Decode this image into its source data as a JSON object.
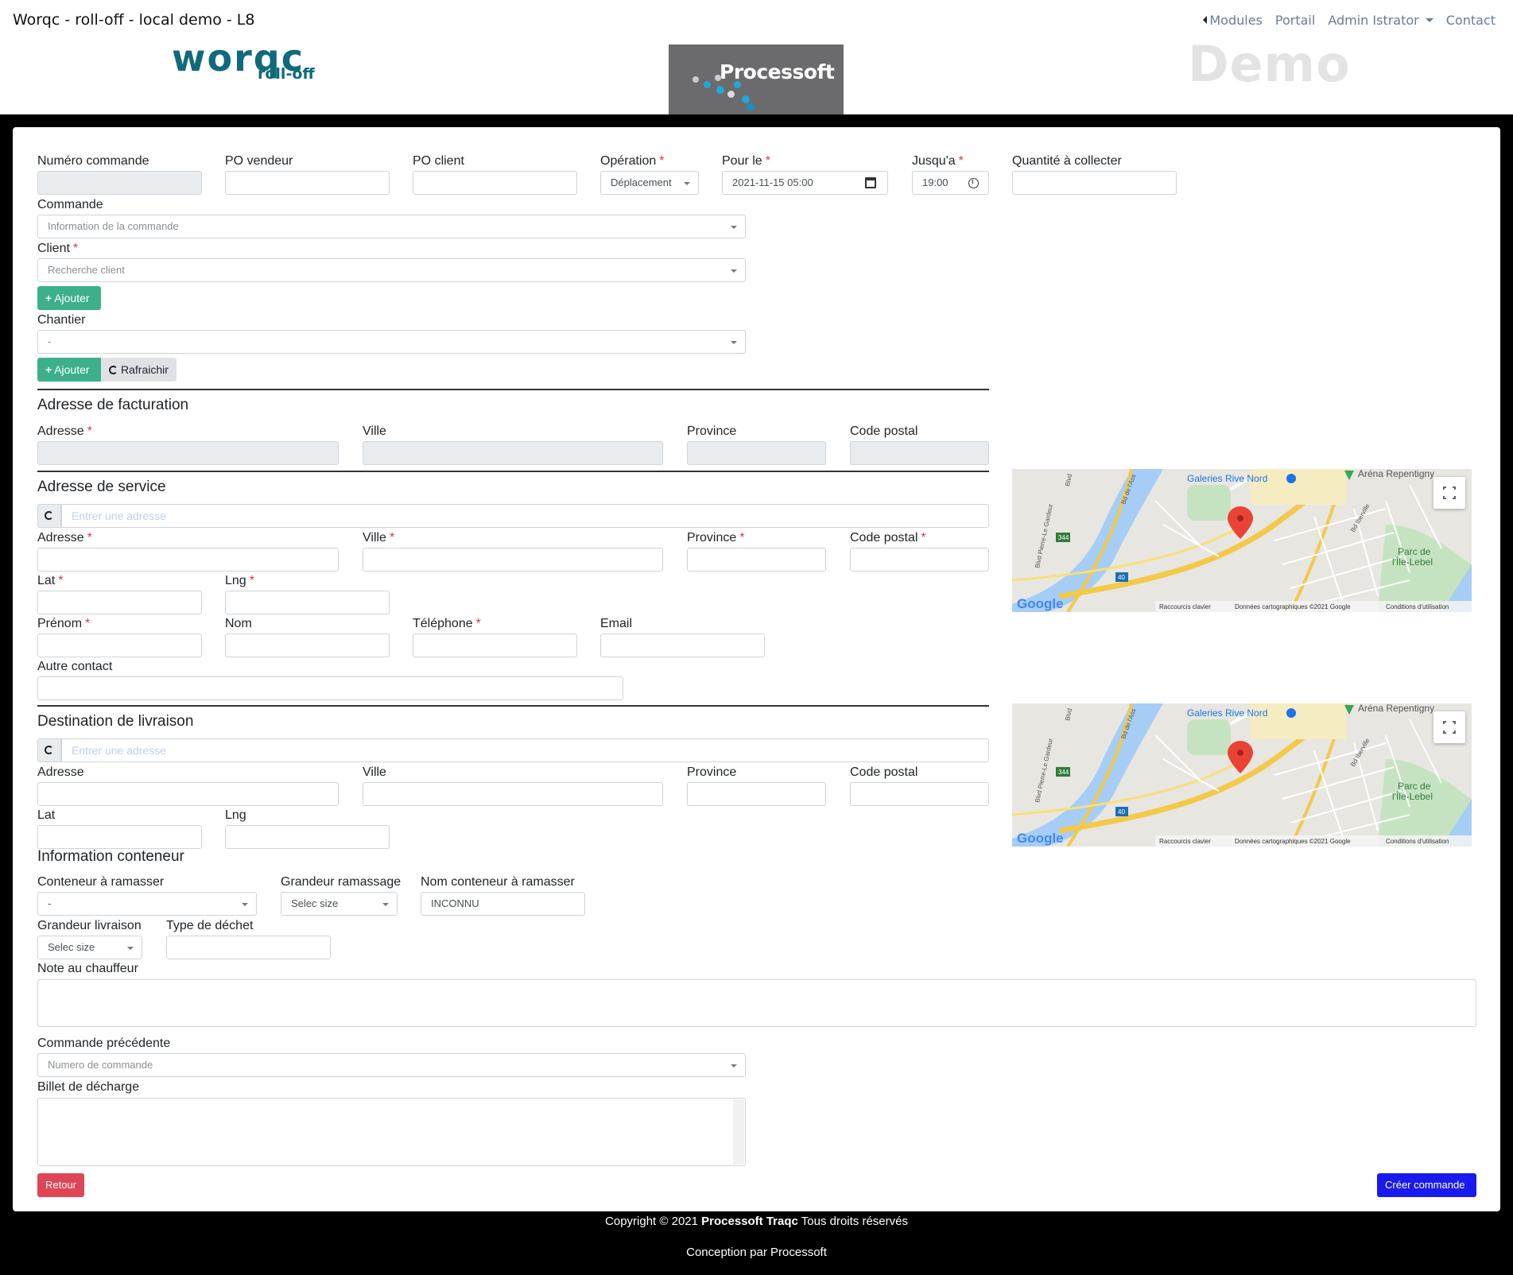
{
  "header": {
    "app_title": "Worqc - roll-off - local demo - L8",
    "nav": {
      "modules": "Modules",
      "portail": "Portail",
      "user": "Admin Istrator",
      "contact": "Contact"
    },
    "logos": {
      "worqc_big": "worqc",
      "worqc_small": "roll-off",
      "processoft": "Processoft",
      "demo": "Demo"
    }
  },
  "order": {
    "numero_label": "Numéro commande",
    "numero_value": "",
    "po_vendeur_label": "PO vendeur",
    "po_vendeur_value": "",
    "po_client_label": "PO client",
    "po_client_value": "",
    "operation_label": "Opération",
    "operation_value": "Déplacement",
    "pour_le_label": "Pour le",
    "pour_le_value": "2021-11-15 05:00",
    "jusqua_label": "Jusqu'a",
    "jusqua_value": "19:00",
    "quantite_label": "Quantité à collecter",
    "quantite_value": "",
    "commande_label": "Commande",
    "commande_placeholder": "Information de la commande",
    "client_label": "Client",
    "client_placeholder": "Recherche client",
    "ajouter_label": "Ajouter",
    "chantier_label": "Chantier",
    "chantier_value": "-",
    "rafraichir_label": "Rafraichir"
  },
  "billing": {
    "title": "Adresse de facturation",
    "adresse_label": "Adresse",
    "ville_label": "Ville",
    "province_label": "Province",
    "code_postal_label": "Code postal"
  },
  "service": {
    "title": "Adresse de service",
    "search_placeholder": "Entrer une adresse",
    "adresse_label": "Adresse",
    "ville_label": "Ville",
    "province_label": "Province",
    "code_postal_label": "Code postal",
    "lat_label": "Lat",
    "lng_label": "Lng",
    "prenom_label": "Prénom",
    "nom_label": "Nom",
    "telephone_label": "Téléphone",
    "email_label": "Email",
    "autre_contact_label": "Autre contact"
  },
  "delivery": {
    "title": "Destination de livraison",
    "search_placeholder": "Entrer une adresse",
    "adresse_label": "Adresse",
    "ville_label": "Ville",
    "province_label": "Province",
    "code_postal_label": "Code postal",
    "lat_label": "Lat",
    "lng_label": "Lng"
  },
  "map": {
    "poi_galeries": "Galeries Rive Nord",
    "poi_arena": "Aréna Repentigny",
    "poi_parc_1": "Parc de",
    "poi_parc_2": "l'Île-Lebel",
    "road_344": "344",
    "road_40": "40",
    "street_pierre": "Blvd Pierre-Le Gardeur",
    "street_iberville": "Bd Iberville",
    "street_assomption": "Bd de l'Ass",
    "street_blvd": "Blvd",
    "google": "Google",
    "attr_shortcuts": "Raccourcis clavier",
    "attr_data": "Données cartographiques ©2021 Google",
    "attr_terms": "Conditions d'utilisation"
  },
  "container": {
    "title": "Information conteneur",
    "conteneur_label": "Conteneur à ramasser",
    "conteneur_value": "-",
    "grandeur_ramassage_label": "Grandeur ramassage",
    "grandeur_ramassage_value": "Selec size",
    "nom_conteneur_label": "Nom conteneur à ramasser",
    "nom_conteneur_value": "INCONNU",
    "grandeur_livraison_label": "Grandeur livraison",
    "grandeur_livraison_value": "Selec size",
    "type_dechet_label": "Type de déchet",
    "type_dechet_value": "",
    "note_label": "Note au chauffeur",
    "commande_precedente_label": "Commande précédente",
    "commande_precedente_placeholder": "Numero de commande",
    "billet_label": "Billet de décharge"
  },
  "actions": {
    "retour": "Retour",
    "creer": "Créer commande"
  },
  "footer": {
    "copyright_prefix": "Copyright © 2021 ",
    "copyright_brand": "Processoft Traqc",
    "copyright_suffix": " Tous droits réservés",
    "conception": "Conception par Processoft"
  },
  "colors": {
    "accent_green": "#3cb08a",
    "danger": "#e04555",
    "primary": "#1a1aee",
    "brand_teal": "#0f6a7c"
  }
}
